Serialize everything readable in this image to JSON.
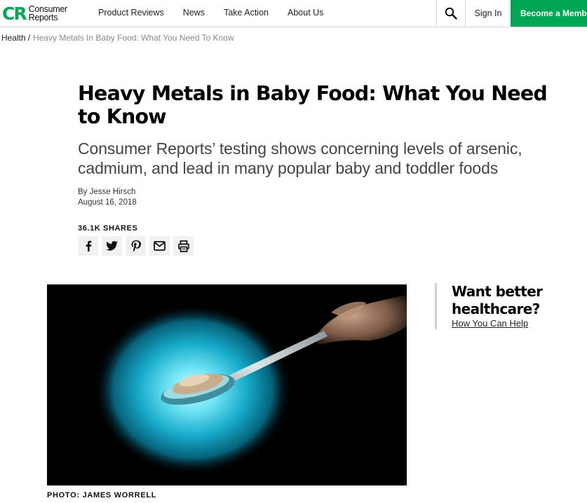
{
  "header": {
    "logo_mark": "CR",
    "logo_line1": "Consumer",
    "logo_line2": "Reports",
    "nav": [
      {
        "label": "Product Reviews"
      },
      {
        "label": "News"
      },
      {
        "label": "Take Action"
      },
      {
        "label": "About Us"
      }
    ],
    "search_icon": "search-icon",
    "signin_label": "Sign In",
    "member_label": "Become a Memb",
    "accent_color": "#00a651"
  },
  "breadcrumb": {
    "section": "Health",
    "separator": "/",
    "current": "Heavy Metals In Baby Food: What You Need To Know"
  },
  "article": {
    "title": "Heavy Metals in Baby Food: What You Need to Know",
    "dek": "Consumer Reports’ testing shows concerning levels of arsenic, cadmium, and lead in many popular baby and toddler foods",
    "author": "By Jesse Hirsch",
    "date": "August 16, 2018",
    "shares_label": "36.1K SHARES",
    "share_icons": [
      "facebook-icon",
      "twitter-icon",
      "pinterest-icon",
      "email-icon",
      "print-icon"
    ],
    "photo_credit": "PHOTO: JAMES WORRELL"
  },
  "promo": {
    "title_line1": "Want better",
    "title_line2": "healthcare?",
    "link": "How You Can Help"
  }
}
